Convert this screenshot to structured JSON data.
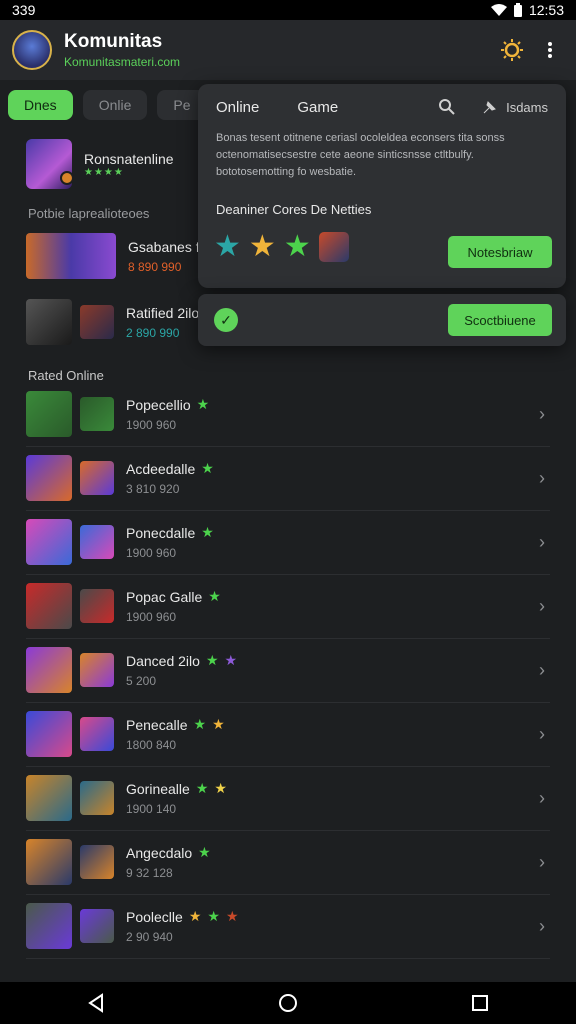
{
  "status": {
    "left": "339",
    "time": "12:53"
  },
  "appbar": {
    "title": "Komunitas",
    "subtitle": "Komunitasmateri.com"
  },
  "chips": [
    {
      "label": "Dnes"
    },
    {
      "label": "Onlie"
    },
    {
      "label": "Pe"
    }
  ],
  "featured": {
    "name": "Ronsnatenline",
    "rating": "★★★★"
  },
  "sections": {
    "top": "Potbie laprealioteoes",
    "online": "Rated Online"
  },
  "top_rows": [
    {
      "name": "Gsabanes fle",
      "sub": "8 890 990"
    },
    {
      "name": "Ratified 2ilo",
      "sub": "2 890 990"
    }
  ],
  "rows": [
    {
      "name": "Popecellio",
      "sub": "1900 960",
      "stars": [
        "#4cd34c"
      ]
    },
    {
      "name": "Acdeedalle",
      "sub": "3 810 920",
      "stars": [
        "#4cd34c"
      ]
    },
    {
      "name": "Ponecdalle",
      "sub": "1900 960",
      "stars": [
        "#4cd34c"
      ]
    },
    {
      "name": "Popac Galle",
      "sub": "1900 960",
      "stars": [
        "#4cd34c"
      ]
    },
    {
      "name": "Danced 2ilo",
      "sub": "5 200",
      "stars": [
        "#4cd34c",
        "#8d5ad8"
      ]
    },
    {
      "name": "Penecalle",
      "sub": "1800 840",
      "stars": [
        "#4cd34c",
        "#f0b43a"
      ]
    },
    {
      "name": "Gorinealle",
      "sub": "1900 140",
      "stars": [
        "#4cd34c",
        "#f0d24a"
      ]
    },
    {
      "name": "Angecdalo",
      "sub": "9 32 128",
      "stars": [
        "#4cd34c"
      ]
    },
    {
      "name": "Pooleclle",
      "sub": "2 90 940",
      "stars": [
        "#f0b43a",
        "#4cd34c",
        "#c84a2a"
      ]
    }
  ],
  "popup": {
    "tabs": [
      "Online",
      "Game"
    ],
    "search_icon": "search-icon",
    "right_label": "Isdams",
    "desc": "Bonas tesent otitnene ceriasl ocoleldea econsers tita sonss octenomatisecsestre cete aeone sinticsnsse ctltbulfy. bototosemotting fo wesbatie.",
    "label": "Deaniner Cores De Netties",
    "stars": [
      "#2ba6a6",
      "#f0b43a",
      "#4cd34c"
    ],
    "button": "Notesbriaw"
  },
  "popup2": {
    "button": "Scoctbiuene"
  }
}
